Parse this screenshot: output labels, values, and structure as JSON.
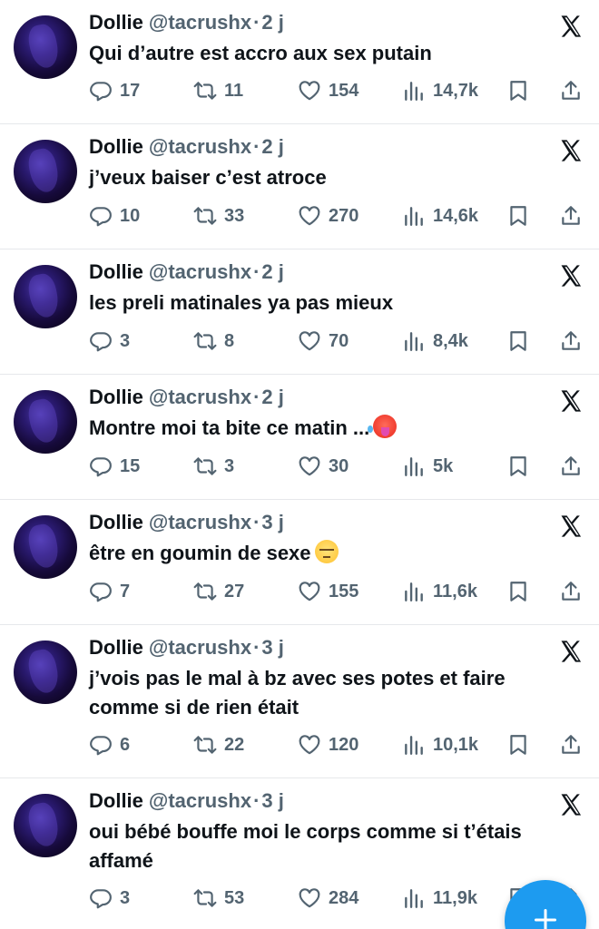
{
  "tweets": [
    {
      "name": "Dollie",
      "handle": "@tacrushx",
      "time": "2 j",
      "text": "Qui d’autre est accro aux sex putain",
      "emoji": "",
      "replies": "17",
      "retweets": "11",
      "likes": "154",
      "views": "14,7k"
    },
    {
      "name": "Dollie",
      "handle": "@tacrushx",
      "time": "2 j",
      "text": "j’veux baiser c’est atroce",
      "emoji": "",
      "replies": "10",
      "retweets": "33",
      "likes": "270",
      "views": "14,6k"
    },
    {
      "name": "Dollie",
      "handle": "@tacrushx",
      "time": "2 j",
      "text": "les preli matinales ya pas mieux",
      "emoji": "",
      "replies": "3",
      "retweets": "8",
      "likes": "70",
      "views": "8,4k"
    },
    {
      "name": "Dollie",
      "handle": "@tacrushx",
      "time": "2 j",
      "text": "Montre moi ta bite ce matin ...",
      "emoji": "hot-face-emoji",
      "replies": "15",
      "retweets": "3",
      "likes": "30",
      "views": "5k"
    },
    {
      "name": "Dollie",
      "handle": "@tacrushx",
      "time": "3 j",
      "text": "être en goumin de sexe",
      "emoji": "pensive-face-emoji",
      "replies": "7",
      "retweets": "27",
      "likes": "155",
      "views": "11,6k"
    },
    {
      "name": "Dollie",
      "handle": "@tacrushx",
      "time": "3 j",
      "text": "j’vois pas le mal à bz avec ses potes et faire comme si de rien était",
      "emoji": "",
      "replies": "6",
      "retweets": "22",
      "likes": "120",
      "views": "10,1k"
    },
    {
      "name": "Dollie",
      "handle": "@tacrushx",
      "time": "3 j",
      "text": "oui bébé bouffe moi le corps comme si t’étais affamé",
      "emoji": "",
      "replies": "3",
      "retweets": "53",
      "likes": "284",
      "views": "11,9k"
    }
  ],
  "colors": {
    "text": "#0f1419",
    "secondary": "#536471",
    "accent": "#1d9bf0",
    "divider": "#e6e8eb"
  },
  "icons": [
    "reply-icon",
    "retweet-icon",
    "like-icon",
    "views-icon",
    "bookmark-icon",
    "share-icon",
    "x-logo-icon",
    "compose-plus-icon"
  ]
}
